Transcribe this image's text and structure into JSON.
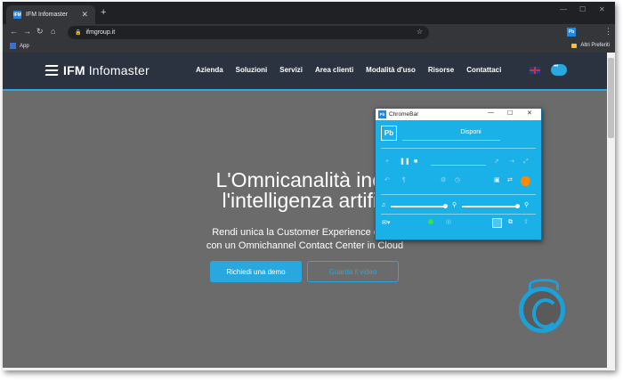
{
  "browser": {
    "tab_title": "IFM Infomaster",
    "favicon_text": "IFM",
    "url": "ifmgroup.it",
    "extension_label": "Pb",
    "bookmarks": {
      "apps_label": "App",
      "other_label": "Altri Preferiti"
    }
  },
  "site": {
    "brand_strong": "IFM",
    "brand_rest": "Infomaster",
    "nav": [
      "Azienda",
      "Soluzioni",
      "Servizi",
      "Area clienti",
      "Modalità d'uso",
      "Risorse",
      "Contattaci"
    ],
    "hero_line1": "L'Omnicanalità inco",
    "hero_line2": "l'intelligenza artific",
    "sub_line1": "Rendi unica la Customer Experience dei tu",
    "sub_line2": "con un Omnichannel Contact Center in Cloud",
    "btn_demo": "Richiedi una demo",
    "btn_video": "Guarda il video"
  },
  "chromebar": {
    "title": "ChromeBar",
    "logo": "Pb",
    "status": "Disponi"
  },
  "colors": {
    "accent": "#29a8e0",
    "header_bg": "#2b3340",
    "page_bg": "#6b6b6b",
    "chromebar_bg": "#1ab0e8",
    "orange": "#ff8a00",
    "green": "#3ddc4b"
  }
}
